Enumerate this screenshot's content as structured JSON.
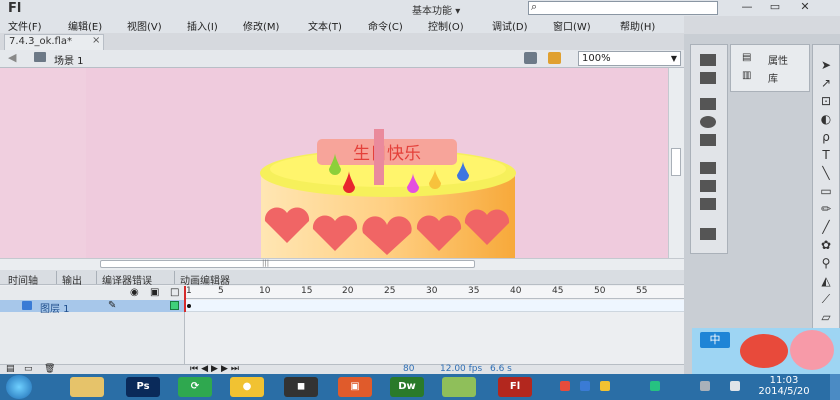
{
  "app": {
    "logo": "Fl",
    "preset": "基本功能",
    "preset_arrow": "▾"
  },
  "search": {
    "icon": "search-icon",
    "placeholder": ""
  },
  "window_controls": {
    "minimize": "—",
    "maximize": "▭",
    "close": "✕"
  },
  "menu": [
    "文件(F)",
    "编辑(E)",
    "视图(V)",
    "插入(I)",
    "修改(M)",
    "文本(T)",
    "命令(C)",
    "控制(O)",
    "调试(D)",
    "窗口(W)",
    "帮助(H)"
  ],
  "document": {
    "tab": "7.4.3_ok.fla*",
    "close": "×"
  },
  "edit_bar": {
    "scene": "场景 1",
    "zoom": "100%"
  },
  "stage": {
    "banner_text": "生日快乐",
    "background_color": "#f0cfdf"
  },
  "timeline": {
    "tabs": [
      "时间轴",
      "输出",
      "编译器错误",
      "动画编辑器"
    ],
    "ruler": [
      "1",
      "5",
      "10",
      "15",
      "20",
      "25",
      "30",
      "35",
      "40",
      "45",
      "50",
      "55"
    ],
    "layer": "图层 1",
    "status": {
      "frame": "80",
      "fps": "12.00 fps",
      "time": "6.6 s"
    }
  },
  "panels": {
    "properties": "属性",
    "library": "库"
  },
  "taskbar": {
    "time": "11:03",
    "date": "2014/5/20"
  },
  "accent": "#2a6ea6"
}
